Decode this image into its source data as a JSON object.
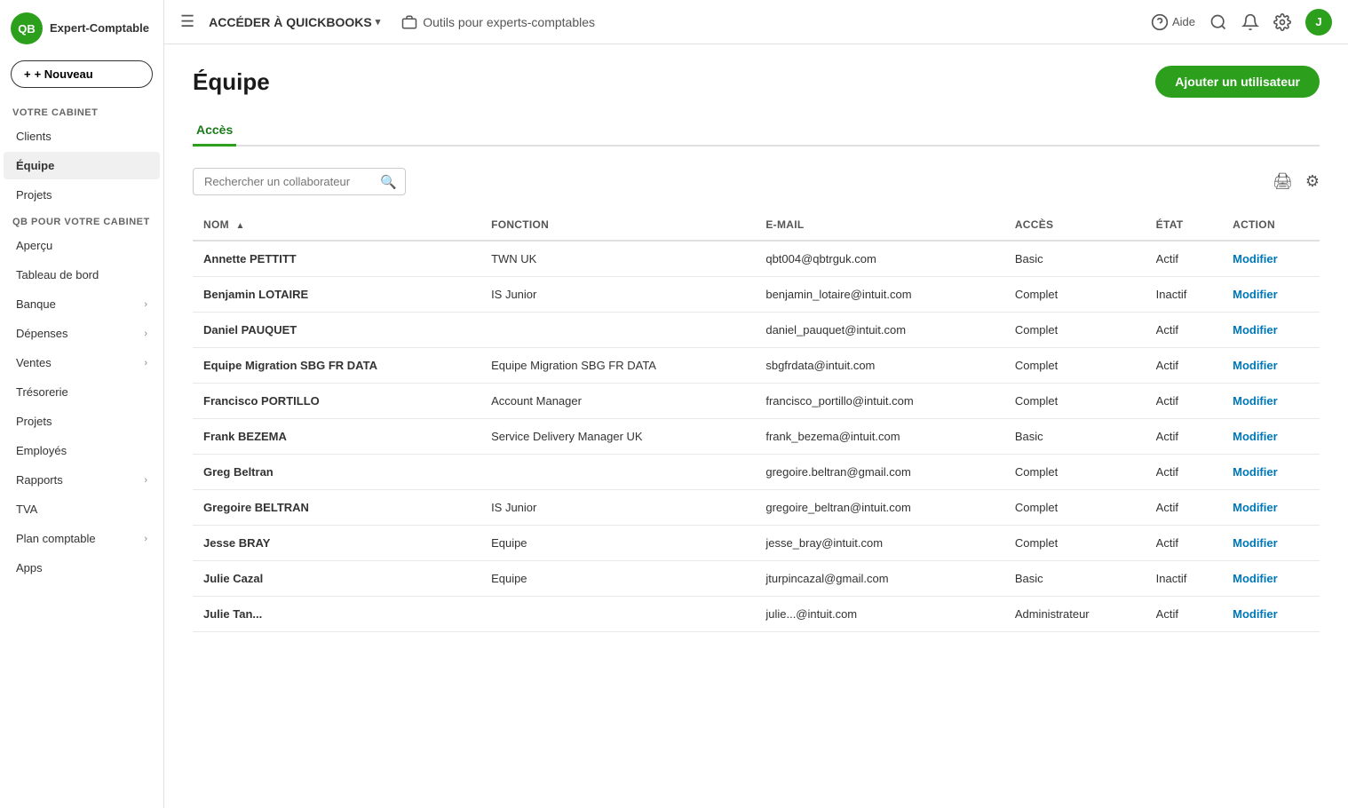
{
  "logo": {
    "initials": "QB",
    "text": "Expert-Comptable"
  },
  "sidebar": {
    "new_button": "+ Nouveau",
    "section_cabinet": "VOTRE CABINET",
    "section_qb": "QB POUR VOTRE CABINET",
    "items_cabinet": [
      {
        "label": "Clients",
        "active": false,
        "has_arrow": false
      },
      {
        "label": "Équipe",
        "active": true,
        "has_arrow": false
      },
      {
        "label": "Projets",
        "active": false,
        "has_arrow": false
      }
    ],
    "items_qb": [
      {
        "label": "Aperçu",
        "active": false,
        "has_arrow": false
      },
      {
        "label": "Tableau de bord",
        "active": false,
        "has_arrow": false
      },
      {
        "label": "Banque",
        "active": false,
        "has_arrow": true
      },
      {
        "label": "Dépenses",
        "active": false,
        "has_arrow": true
      },
      {
        "label": "Ventes",
        "active": false,
        "has_arrow": true
      },
      {
        "label": "Trésorerie",
        "active": false,
        "has_arrow": false
      },
      {
        "label": "Projets",
        "active": false,
        "has_arrow": false
      },
      {
        "label": "Employés",
        "active": false,
        "has_arrow": false
      },
      {
        "label": "Rapports",
        "active": false,
        "has_arrow": true
      },
      {
        "label": "TVA",
        "active": false,
        "has_arrow": false
      },
      {
        "label": "Plan comptable",
        "active": false,
        "has_arrow": true
      },
      {
        "label": "Apps",
        "active": false,
        "has_arrow": false
      }
    ]
  },
  "topnav": {
    "acceder_label": "ACCÉDER À QUICKBOOKS",
    "outils_label": "Outils pour experts-comptables",
    "aide_label": "Aide",
    "avatar_letter": "J"
  },
  "page": {
    "title": "Équipe",
    "add_user_btn": "Ajouter un utilisateur",
    "tab_acces": "Accès",
    "search_placeholder": "Rechercher un collaborateur",
    "columns": [
      {
        "label": "NOM",
        "sortable": true
      },
      {
        "label": "FONCTION",
        "sortable": false
      },
      {
        "label": "E-MAIL",
        "sortable": false
      },
      {
        "label": "ACCÈS",
        "sortable": false
      },
      {
        "label": "ÉTAT",
        "sortable": false
      },
      {
        "label": "ACTION",
        "sortable": false
      }
    ],
    "rows": [
      {
        "nom": "Annette PETTITT",
        "fonction": "TWN UK",
        "email": "qbt004@qbtrguk.com",
        "acces": "Basic",
        "etat": "Actif",
        "action": "Modifier"
      },
      {
        "nom": "Benjamin LOTAIRE",
        "fonction": "IS Junior",
        "email": "benjamin_lotaire@intuit.com",
        "acces": "Complet",
        "etat": "Inactif",
        "action": "Modifier"
      },
      {
        "nom": "Daniel PAUQUET",
        "fonction": "",
        "email": "daniel_pauquet@intuit.com",
        "acces": "Complet",
        "etat": "Actif",
        "action": "Modifier"
      },
      {
        "nom": "Equipe Migration SBG FR DATA",
        "fonction": "Equipe Migration SBG FR DATA",
        "email": "sbgfrdata@intuit.com",
        "acces": "Complet",
        "etat": "Actif",
        "action": "Modifier"
      },
      {
        "nom": "Francisco PORTILLO",
        "fonction": "Account Manager",
        "email": "francisco_portillo@intuit.com",
        "acces": "Complet",
        "etat": "Actif",
        "action": "Modifier"
      },
      {
        "nom": "Frank BEZEMA",
        "fonction": "Service Delivery Manager UK",
        "email": "frank_bezema@intuit.com",
        "acces": "Basic",
        "etat": "Actif",
        "action": "Modifier"
      },
      {
        "nom": "Greg Beltran",
        "fonction": "",
        "email": "gregoire.beltran@gmail.com",
        "acces": "Complet",
        "etat": "Actif",
        "action": "Modifier"
      },
      {
        "nom": "Gregoire BELTRAN",
        "fonction": "IS Junior",
        "email": "gregoire_beltran@intuit.com",
        "acces": "Complet",
        "etat": "Actif",
        "action": "Modifier"
      },
      {
        "nom": "Jesse BRAY",
        "fonction": "Equipe",
        "email": "jesse_bray@intuit.com",
        "acces": "Complet",
        "etat": "Actif",
        "action": "Modifier"
      },
      {
        "nom": "Julie Cazal",
        "fonction": "Equipe",
        "email": "jturpincazal@gmail.com",
        "acces": "Basic",
        "etat": "Inactif",
        "action": "Modifier"
      },
      {
        "nom": "Julie Tan...",
        "fonction": "",
        "email": "julie...@intuit.com",
        "acces": "Administrateur",
        "etat": "Actif",
        "action": "Modifier"
      }
    ]
  }
}
